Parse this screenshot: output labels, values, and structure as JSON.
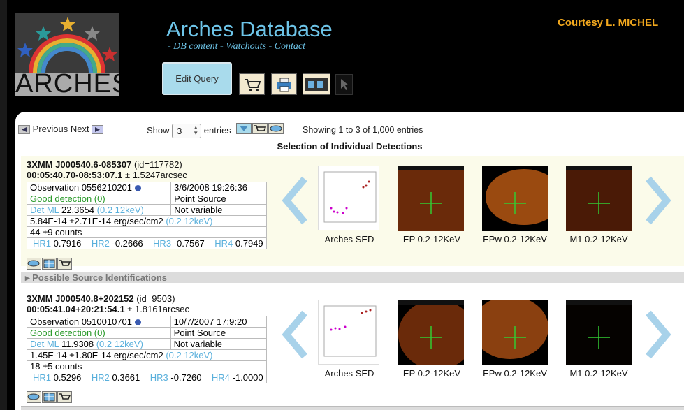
{
  "header": {
    "logo_text": "ARCHES",
    "title": "Arches Database",
    "subnav": "- DB content - Watchouts - Contact",
    "courtesy": "Courtesy L. MICHEL",
    "edit_query_label": "Edit Query"
  },
  "pager": {
    "previous_label": "Previous",
    "next_label": "Next",
    "show_label": "Show",
    "entries_value": "3",
    "entries_label": "entries",
    "showing_text": "Showing 1 to 3 of 1,000 entries"
  },
  "section_title": "Selection of Individual Detections",
  "detections": [
    {
      "name": "3XMM J000540.6-085307",
      "id_text": "(id=117782)",
      "coord": "00:05:40.70-08:53:07.1",
      "error": "± 1.5247arcsec",
      "observation_label": "Observation 0556210201",
      "date": "3/6/2008 19:26:36",
      "detection_quality": "Good detection (0)",
      "source_type": "Point Source",
      "det_ml_label": "Det ML",
      "det_ml_value": "22.3654",
      "band": "(0.2 12keV)",
      "variability": "Not variable",
      "flux": "5.84E-14 ±2.71E-14 erg/sec/cm2",
      "flux_band": "(0.2 12keV)",
      "counts": "44 ±9 counts",
      "hr1_label": "HR1",
      "hr1": "0.7916",
      "hr2_label": "HR2",
      "hr2": "-0.2666",
      "hr3_label": "HR3",
      "hr3": "-0.7567",
      "hr4_label": "HR4",
      "hr4": "0.7949",
      "sed_caption": "Arches SED",
      "img1_caption": "EP 0.2-12KeV",
      "img2_caption": "EPw 0.2-12KeV",
      "img3_caption": "M1 0.2-12KeV"
    },
    {
      "name": "3XMM J000540.8+202152",
      "id_text": "(id=9503)",
      "coord": "00:05:41.04+20:21:54.1",
      "error": "± 1.8161arcsec",
      "observation_label": "Observation 0510010701",
      "date": "10/7/2007 17:9:20",
      "detection_quality": "Good detection (0)",
      "source_type": "Point Source",
      "det_ml_label": "Det ML",
      "det_ml_value": "11.9308",
      "band": "(0.2 12keV)",
      "variability": "Not variable",
      "flux": "1.45E-14 ±1.80E-14 erg/sec/cm2",
      "flux_band": "(0.2 12keV)",
      "counts": "18 ±5 counts",
      "hr1_label": "HR1",
      "hr1": "0.5296",
      "hr2_label": "HR2",
      "hr2": "0.3661",
      "hr3_label": "HR3",
      "hr3": "-0.7260",
      "hr4_label": "HR4",
      "hr4": "-1.0000",
      "sed_caption": "Arches SED",
      "img1_caption": "EP 0.2-12KeV",
      "img2_caption": "EPw 0.2-12KeV",
      "img3_caption": "M1 0.2-12KeV"
    }
  ],
  "possible_ids_label": "Possible Source Identifications",
  "colors": {
    "accent": "#6dc4e8",
    "courtesy": "#f2a81d",
    "panel_bg": "#fbfbea"
  }
}
